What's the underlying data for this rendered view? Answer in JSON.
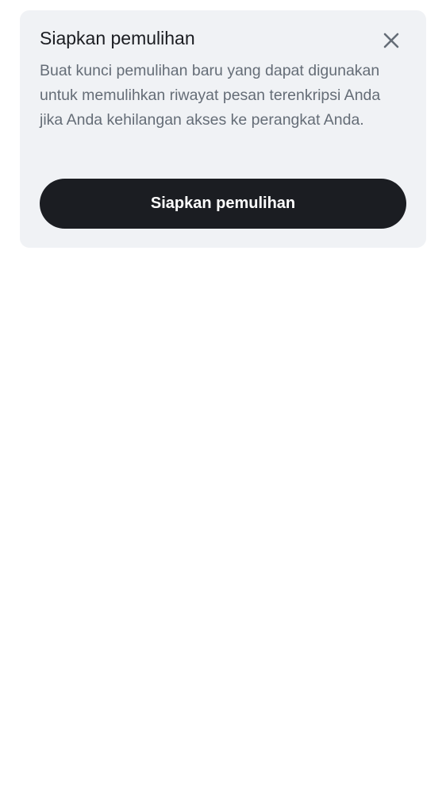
{
  "card": {
    "title": "Siapkan pemulihan",
    "description": "Buat kunci pemulihan baru yang dapat digunakan untuk memulihkan riwayat pesan terenkripsi Anda jika Anda kehilangan akses ke perangkat Anda.",
    "button_label": "Siapkan pemulihan",
    "close_icon": "close-icon"
  },
  "colors": {
    "card_background": "#f0f2f5",
    "title": "#1b1d22",
    "description": "#656d77",
    "button_background": "#1b1d22",
    "button_text": "#ffffff",
    "close_icon": "#656d77"
  }
}
